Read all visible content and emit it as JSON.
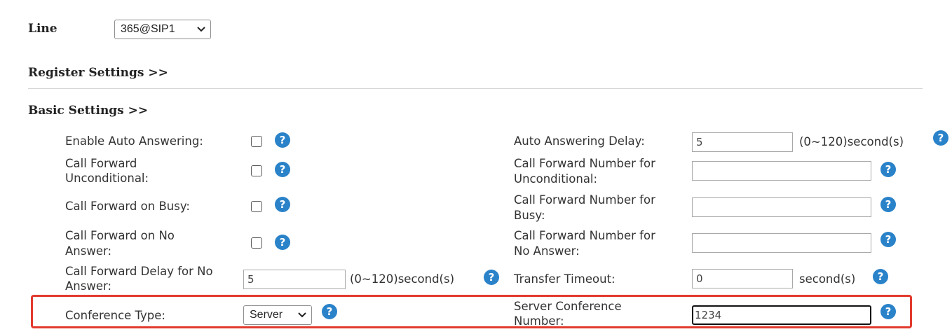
{
  "line": {
    "label": "Line",
    "selected": "365@SIP1"
  },
  "sections": {
    "register": "Register Settings >>",
    "basic": "Basic Settings >>"
  },
  "left": {
    "auto_answer": "Enable Auto Answering:",
    "cf_uncond_1": "Call Forward",
    "cf_uncond_2": "Unconditional:",
    "cf_busy": "Call Forward on Busy:",
    "cf_noans_1": "Call Forward on No",
    "cf_noans_2": "Answer:",
    "cf_delay_1": "Call Forward Delay for No",
    "cf_delay_2": "Answer:",
    "cf_delay_value": "5",
    "cf_delay_unit": "(0~120)second(s)",
    "conf_type": "Conference Type:",
    "conf_type_selected": "Server"
  },
  "right": {
    "aa_delay": "Auto Answering Delay:",
    "aa_delay_value": "5",
    "aa_delay_unit": "(0~120)second(s)",
    "cfn_uncond_1": "Call Forward Number for",
    "cfn_uncond_2": "Unconditional:",
    "cfn_uncond_value": "",
    "cfn_busy_1": "Call Forward Number for",
    "cfn_busy_2": "Busy:",
    "cfn_busy_value": "",
    "cfn_noans_1": "Call Forward Number for",
    "cfn_noans_2": "No Answer:",
    "cfn_noans_value": "",
    "transfer_timeout": "Transfer Timeout:",
    "transfer_timeout_value": "0",
    "transfer_timeout_unit": "second(s)",
    "server_conf_1": "Server Conference",
    "server_conf_2": "Number:",
    "server_conf_value": "1234"
  },
  "help_glyph": "?",
  "icons": {
    "help": "help-icon",
    "dropdown": "chevron-down-icon"
  },
  "colors": {
    "help_icon": "#2a82c9",
    "highlight_border": "#e23a2e"
  }
}
